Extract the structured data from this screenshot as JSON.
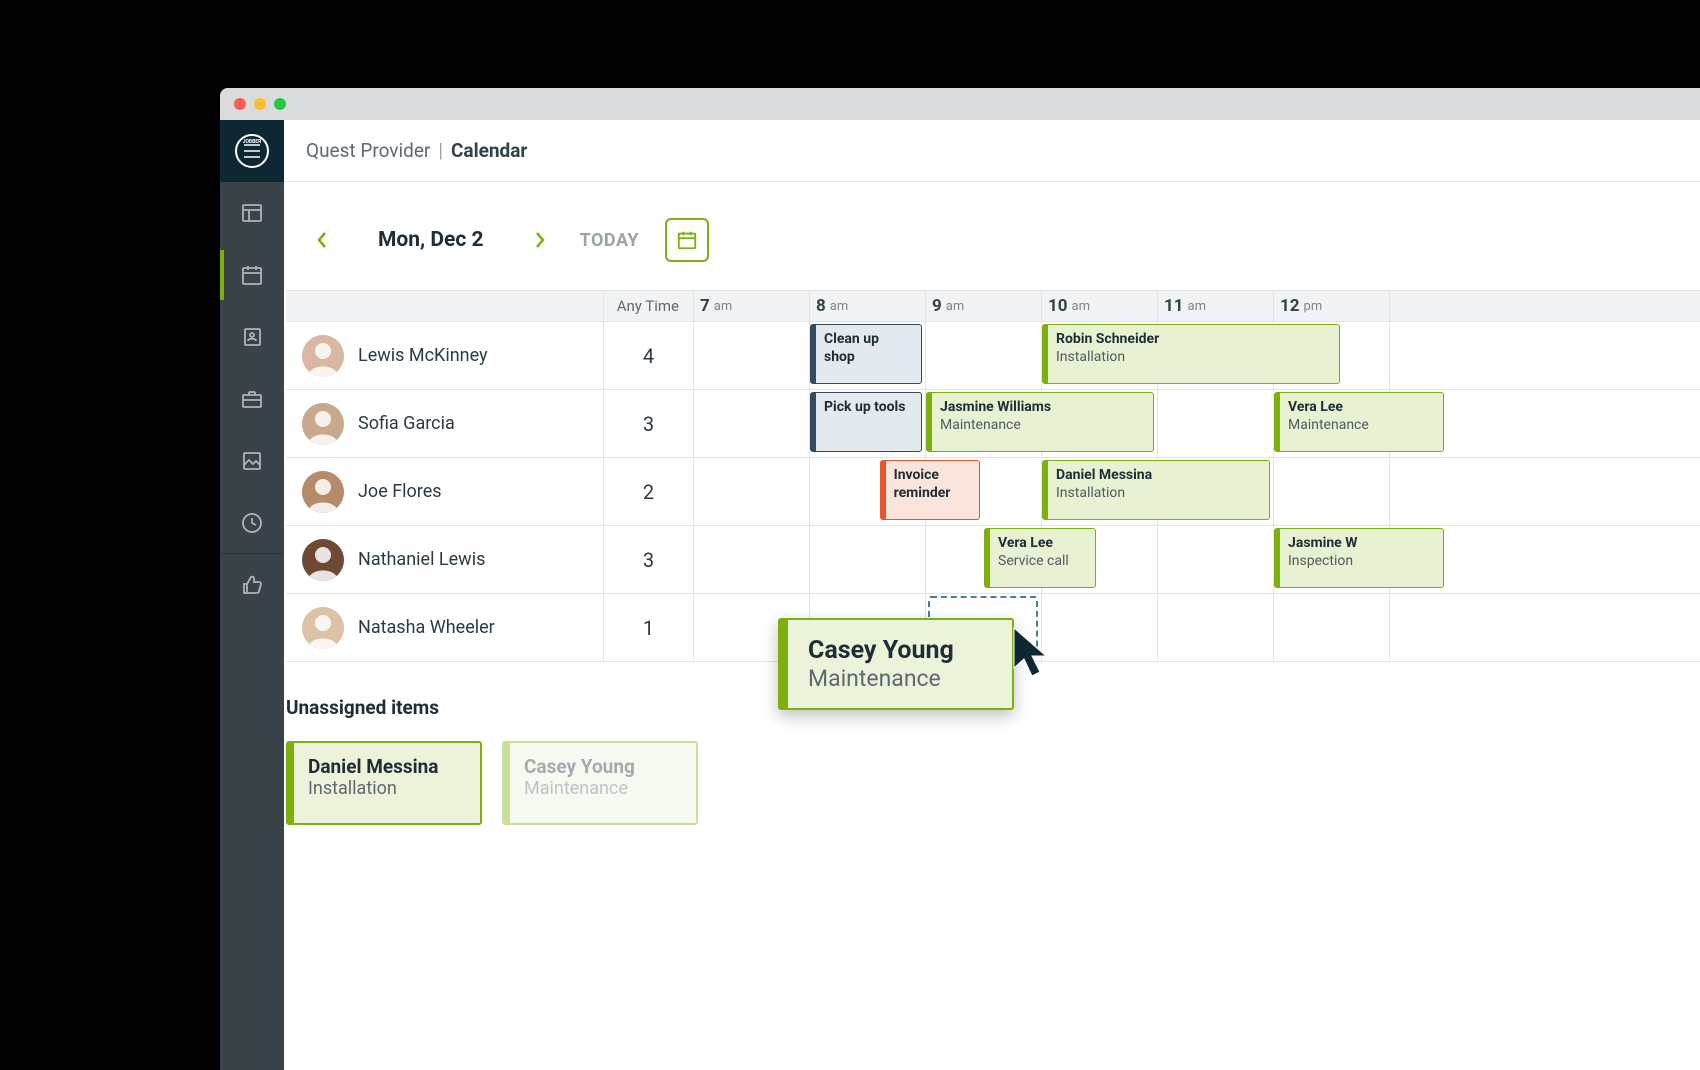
{
  "breadcrumb": {
    "org": "Quest Provider",
    "page": "Calendar"
  },
  "toolbar": {
    "date": "Mon, Dec 2",
    "today_label": "TODAY"
  },
  "headers": {
    "anytime": "Any Time",
    "hours": [
      {
        "num": "7",
        "sfx": "am"
      },
      {
        "num": "8",
        "sfx": "am"
      },
      {
        "num": "9",
        "sfx": "am"
      },
      {
        "num": "10",
        "sfx": "am"
      },
      {
        "num": "11",
        "sfx": "am"
      },
      {
        "num": "12",
        "sfx": "pm"
      }
    ]
  },
  "rows": [
    {
      "name": "Lewis McKinney",
      "anytime": "4",
      "events": [
        {
          "color": "blue",
          "title": "Clean up shop",
          "sub": "",
          "start": 8,
          "span": 1
        },
        {
          "color": "green",
          "title": "Robin Schneider",
          "sub": "Installation",
          "start": 10,
          "span": 2.6
        }
      ]
    },
    {
      "name": "Sofia Garcia",
      "anytime": "3",
      "events": [
        {
          "color": "blue",
          "title": "Pick up tools",
          "sub": "",
          "start": 8,
          "span": 1
        },
        {
          "color": "green",
          "title": "Jasmine Williams",
          "sub": "Maintenance",
          "start": 9,
          "span": 2
        },
        {
          "color": "green",
          "title": "Vera Lee",
          "sub": "Maintenance",
          "start": 12,
          "span": 1.5
        }
      ]
    },
    {
      "name": "Joe Flores",
      "anytime": "2",
      "events": [
        {
          "color": "red",
          "title": "Invoice reminder",
          "sub": "",
          "start": 8.6,
          "span": 0.9
        },
        {
          "color": "green",
          "title": "Daniel Messina",
          "sub": "Installation",
          "start": 10,
          "span": 2
        }
      ]
    },
    {
      "name": "Nathaniel Lewis",
      "anytime": "3",
      "events": [
        {
          "color": "green",
          "title": "Vera Lee",
          "sub": "Service call",
          "start": 9.5,
          "span": 1
        },
        {
          "color": "green",
          "title": "Jasmine W",
          "sub": "Inspection",
          "start": 12,
          "span": 1.5
        }
      ]
    },
    {
      "name": "Natasha Wheeler",
      "anytime": "1",
      "events": []
    }
  ],
  "drop_zone": {
    "row": 4,
    "start": 9,
    "span": 1
  },
  "drag_card": {
    "title": "Casey Young",
    "sub": "Maintenance"
  },
  "unassigned": {
    "title": "Unassigned items",
    "items": [
      {
        "title": "Daniel Messina",
        "sub": "Installation",
        "ghost": false
      },
      {
        "title": "Casey Young",
        "sub": "Maintenance",
        "ghost": true
      }
    ]
  },
  "colors": {
    "accent": "#7db00e"
  },
  "avatar_bg": [
    "#d9b7a3",
    "#c9a98e",
    "#b58b6c",
    "#6e4a35",
    "#dcc3a8"
  ]
}
